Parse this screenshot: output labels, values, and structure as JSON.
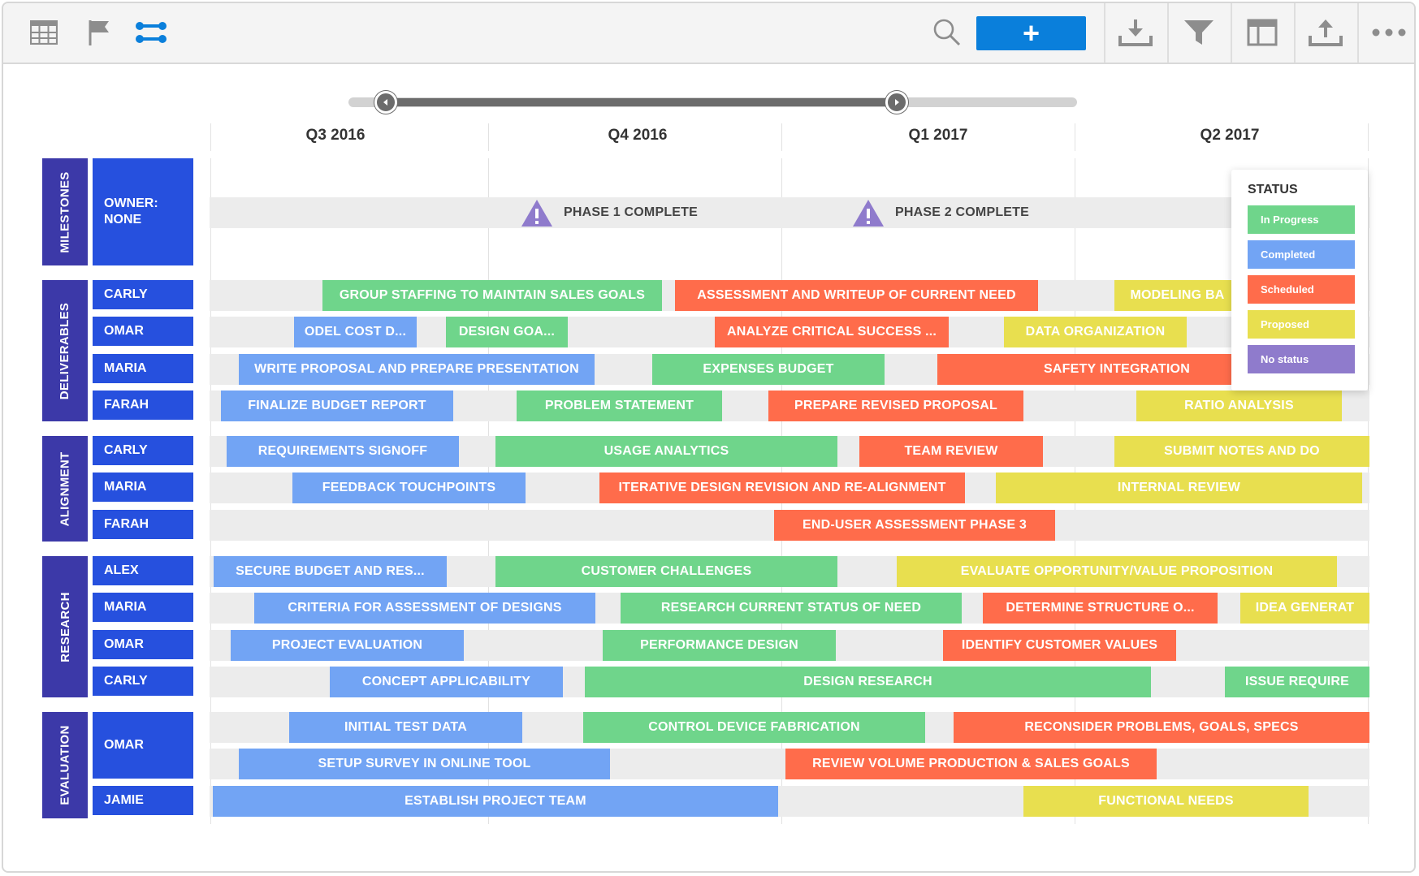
{
  "toolbar": {
    "left_icons": [
      "grid-icon",
      "flag-icon",
      "timeline-icon"
    ],
    "right_icons": [
      "download-icon",
      "filter-icon",
      "layout-icon",
      "upload-icon",
      "more-icon"
    ],
    "add_label": "+"
  },
  "timeline": {
    "quarters": [
      "Q3 2016",
      "Q4 2016",
      "Q1 2017",
      "Q2 2017"
    ]
  },
  "milestones": {
    "group": "MILESTONES",
    "owner": "OWNER:\nNONE",
    "items": [
      {
        "label": "PHASE 1 COMPLETE",
        "icon": "warning-icon"
      },
      {
        "label": "PHASE 2 COMPLETE",
        "icon": "warning-icon"
      }
    ]
  },
  "groups": [
    {
      "name": "DELIVERABLES",
      "rows": [
        {
          "person": "CARLY",
          "bars": [
            {
              "label": "GROUP STAFFING TO MAINTAIN SALES GOALS",
              "status": "In Progress"
            },
            {
              "label": "ASSESSMENT AND WRITEUP OF CURRENT NEED",
              "status": "Scheduled"
            },
            {
              "label": "MODELING BA",
              "status": "Proposed"
            }
          ]
        },
        {
          "person": "OMAR",
          "bars": [
            {
              "label": "ODEL COST D...",
              "status": "Completed"
            },
            {
              "label": "DESIGN GOA...",
              "status": "In Progress"
            },
            {
              "label": "ANALYZE CRITICAL SUCCESS ...",
              "status": "Scheduled"
            },
            {
              "label": "DATA ORGANIZATION",
              "status": "Proposed"
            }
          ]
        },
        {
          "person": "MARIA",
          "bars": [
            {
              "label": "WRITE PROPOSAL AND PREPARE PRESENTATION",
              "status": "Completed"
            },
            {
              "label": "EXPENSES BUDGET",
              "status": "In Progress"
            },
            {
              "label": "SAFETY INTEGRATION",
              "status": "Scheduled"
            }
          ]
        },
        {
          "person": "FARAH",
          "bars": [
            {
              "label": "FINALIZE BUDGET REPORT",
              "status": "Completed"
            },
            {
              "label": "PROBLEM STATEMENT",
              "status": "In Progress"
            },
            {
              "label": "PREPARE REVISED PROPOSAL",
              "status": "Scheduled"
            },
            {
              "label": "RATIO ANALYSIS",
              "status": "Proposed"
            }
          ]
        }
      ]
    },
    {
      "name": "ALIGNMENT",
      "rows": [
        {
          "person": "CARLY",
          "bars": [
            {
              "label": "REQUIREMENTS SIGNOFF",
              "status": "Completed"
            },
            {
              "label": "USAGE ANALYTICS",
              "status": "In Progress"
            },
            {
              "label": "TEAM REVIEW",
              "status": "Scheduled"
            },
            {
              "label": "SUBMIT NOTES AND DO",
              "status": "Proposed"
            }
          ]
        },
        {
          "person": "MARIA",
          "bars": [
            {
              "label": "FEEDBACK TOUCHPOINTS",
              "status": "Completed"
            },
            {
              "label": "ITERATIVE DESIGN REVISION AND RE-ALIGNMENT",
              "status": "Scheduled"
            },
            {
              "label": "INTERNAL REVIEW",
              "status": "Proposed"
            }
          ]
        },
        {
          "person": "FARAH",
          "bars": [
            {
              "label": "END-USER ASSESSMENT PHASE 3",
              "status": "Scheduled"
            }
          ]
        }
      ]
    },
    {
      "name": "RESEARCH",
      "rows": [
        {
          "person": "ALEX",
          "bars": [
            {
              "label": "SECURE BUDGET AND RES...",
              "status": "Completed"
            },
            {
              "label": "CUSTOMER CHALLENGES",
              "status": "In Progress"
            },
            {
              "label": "EVALUATE OPPORTUNITY/VALUE PROPOSITION",
              "status": "Proposed"
            }
          ]
        },
        {
          "person": "MARIA",
          "bars": [
            {
              "label": "CRITERIA FOR ASSESSMENT OF DESIGNS",
              "status": "Completed"
            },
            {
              "label": "RESEARCH CURRENT STATUS OF NEED",
              "status": "In Progress"
            },
            {
              "label": "DETERMINE STRUCTURE O...",
              "status": "Scheduled"
            },
            {
              "label": "IDEA GENERAT",
              "status": "Proposed"
            }
          ]
        },
        {
          "person": "OMAR",
          "bars": [
            {
              "label": "PROJECT EVALUATION",
              "status": "Completed"
            },
            {
              "label": "PERFORMANCE DESIGN",
              "status": "In Progress"
            },
            {
              "label": "IDENTIFY CUSTOMER VALUES",
              "status": "Scheduled"
            }
          ]
        },
        {
          "person": "CARLY",
          "bars": [
            {
              "label": "CONCEPT APPLICABILITY",
              "status": "Completed"
            },
            {
              "label": "DESIGN RESEARCH",
              "status": "In Progress"
            },
            {
              "label": "ISSUE REQUIRE",
              "status": "In Progress"
            }
          ]
        }
      ]
    },
    {
      "name": "EVALUATION",
      "rows": [
        {
          "person": "OMAR",
          "bars": [
            {
              "label": "INITIAL TEST DATA",
              "status": "Completed"
            },
            {
              "label": "CONTROL DEVICE FABRICATION",
              "status": "In Progress"
            },
            {
              "label": "RECONSIDER PROBLEMS, GOALS, SPECS",
              "status": "Scheduled"
            }
          ]
        },
        {
          "person": "",
          "bars": [
            {
              "label": "SETUP SURVEY IN ONLINE TOOL",
              "status": "Completed"
            },
            {
              "label": "REVIEW VOLUME PRODUCTION & SALES GOALS",
              "status": "Scheduled"
            }
          ]
        },
        {
          "person": "JAMIE",
          "bars": [
            {
              "label": "ESTABLISH PROJECT TEAM",
              "status": "Completed"
            },
            {
              "label": "FUNCTIONAL NEEDS",
              "status": "Proposed"
            }
          ]
        }
      ]
    }
  ],
  "legend": {
    "title": "STATUS",
    "items": [
      {
        "label": "In Progress",
        "color": "#6fd58b"
      },
      {
        "label": "Completed",
        "color": "#72a4f4"
      },
      {
        "label": "Scheduled",
        "color": "#ff6c4b"
      },
      {
        "label": "Proposed",
        "color": "#e8df4f"
      },
      {
        "label": "No status",
        "color": "#8f7bcc"
      }
    ]
  },
  "colors": {
    "accent": "#0a7fdb",
    "group_label": "#3c39a8",
    "person_label": "#2650de",
    "milestone_icon": "#8f7bcc"
  }
}
